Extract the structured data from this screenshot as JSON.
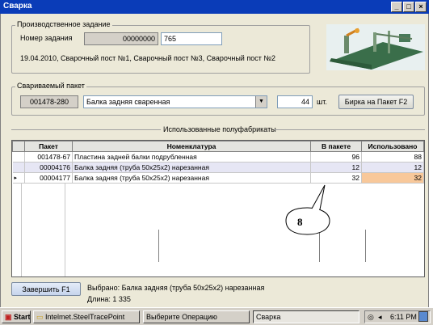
{
  "window": {
    "title": "Сварка"
  },
  "production_task": {
    "legend": "Производственное задание",
    "task_number_label": "Номер задания",
    "task_number_prefix": "00000000",
    "task_number_value": "765",
    "info": "19.04.2010, Сварочный пост №1, Сварочный пост №3, Сварочный пост №2"
  },
  "welded_package": {
    "legend": "Свариваемый пакет",
    "package_code": "001478-280",
    "nomenclature": "Балка задняя сваренная",
    "quantity": "44",
    "unit": "шт.",
    "label_button": "Бирка на Пакет   F2"
  },
  "semi_products": {
    "legend": "Использованные полуфабрикаты",
    "columns": [
      "Пакет",
      "Номенклатура",
      "В пакете",
      "Использовано"
    ],
    "rows": [
      {
        "package": "001478-67",
        "name": "Пластина задней балки подрубленная",
        "in_package": "96",
        "used": "88"
      },
      {
        "package": "00004176",
        "name": "Балка задняя (труба 50x25x2) нарезанная",
        "in_package": "12",
        "used": "12"
      },
      {
        "package": "00004177",
        "name": "Балка задняя (труба 50x25x2) нарезанная",
        "in_package": "32",
        "used": "32"
      }
    ],
    "callout_label": "8"
  },
  "footer": {
    "finish_button": "Завершить      F1",
    "selected_text": "Выбрано: Балка задняя (труба 50x25x2) нарезанная",
    "length_text": "Длина: 1 335"
  },
  "taskbar": {
    "start_label": "Start",
    "items": [
      "Intelmet.SteelTracePoint",
      "Выберите Операцию",
      "Сварка"
    ],
    "clock": "6:11 PM"
  },
  "colors": {
    "titlebar": "#0a3cb8",
    "highlight_cell": "#f8c89a",
    "window_bg": "#ece9d8"
  }
}
